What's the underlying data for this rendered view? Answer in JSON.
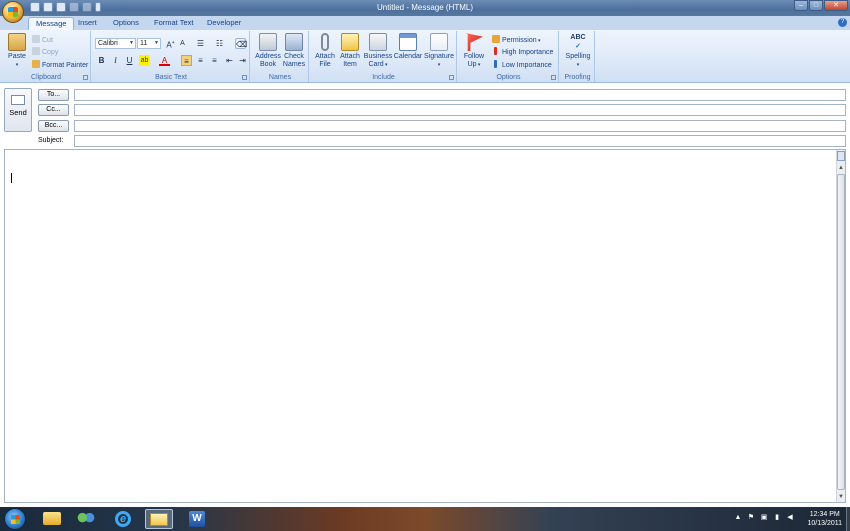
{
  "window": {
    "title": "Untitled - Message (HTML)"
  },
  "tabs": [
    {
      "label": "Message",
      "active": true
    },
    {
      "label": "Insert"
    },
    {
      "label": "Options"
    },
    {
      "label": "Format Text"
    },
    {
      "label": "Developer"
    }
  ],
  "ribbon": {
    "clipboard": {
      "label": "Clipboard",
      "paste": "Paste",
      "cut": "Cut",
      "copy": "Copy",
      "format_painter": "Format Painter"
    },
    "basic_text": {
      "label": "Basic Text",
      "font": "Calibri",
      "size": "11"
    },
    "names": {
      "label": "Names",
      "address_book": [
        "Address",
        "Book"
      ],
      "check_names": [
        "Check",
        "Names"
      ]
    },
    "include": {
      "label": "Include",
      "attach_file": [
        "Attach",
        "File"
      ],
      "attach_item": [
        "Attach",
        "Item"
      ],
      "business_card": [
        "Business",
        "Card"
      ],
      "calendar": "Calendar",
      "signature": "Signature"
    },
    "options": {
      "label": "Options",
      "follow_up": [
        "Follow",
        "Up"
      ],
      "permission": "Permission",
      "high_importance": "High Importance",
      "low_importance": "Low Importance"
    },
    "proofing": {
      "label": "Proofing",
      "spelling": "Spelling"
    }
  },
  "header": {
    "send": "Send",
    "to": "To...",
    "cc": "Cc...",
    "bcc": "Bcc...",
    "subject": "Subject:"
  },
  "taskbar": {
    "time": "12:34 PM",
    "date": "10/13/2011"
  },
  "colors": {
    "accent": "#15428b",
    "ribbon_bg": "#dbe7f7",
    "titlebar": "#4d6f9c"
  }
}
